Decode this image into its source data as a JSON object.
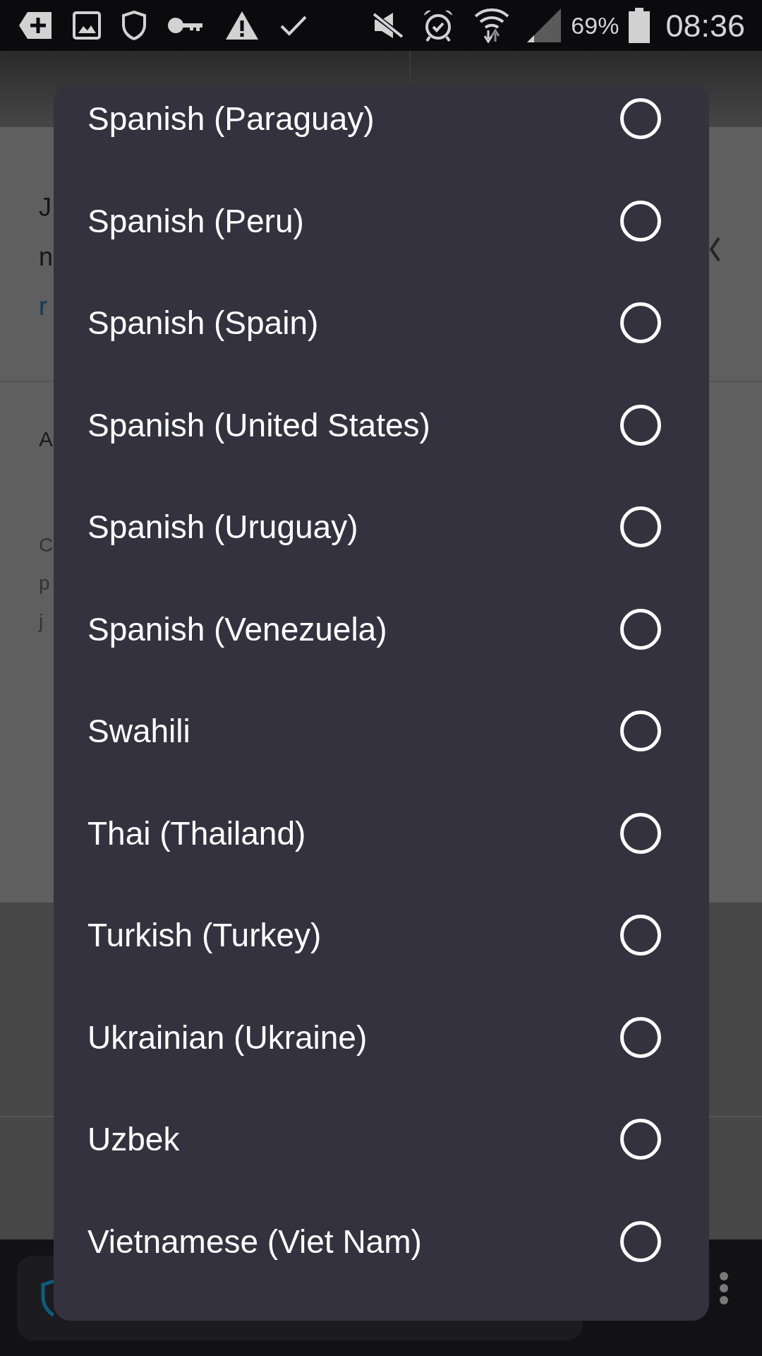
{
  "status_bar": {
    "battery": "69%",
    "time": "08:36"
  },
  "page": {
    "intro": {
      "lines": [
        {
          "text": "J",
          "kind": "text"
        },
        {
          "text": "n",
          "kind": "text"
        },
        {
          "text": "r",
          "kind": "link"
        }
      ]
    },
    "section": {
      "heading": "A",
      "lines": [
        "C",
        "p",
        "j"
      ]
    }
  },
  "dialog": {
    "options": [
      {
        "label": "Spanish (Paraguay)",
        "selected": false
      },
      {
        "label": "Spanish (Peru)",
        "selected": false
      },
      {
        "label": "Spanish (Spain)",
        "selected": false
      },
      {
        "label": "Spanish (United States)",
        "selected": false
      },
      {
        "label": "Spanish (Uruguay)",
        "selected": false
      },
      {
        "label": "Spanish (Venezuela)",
        "selected": false
      },
      {
        "label": "Swahili",
        "selected": false
      },
      {
        "label": "Thai (Thailand)",
        "selected": false
      },
      {
        "label": "Turkish (Turkey)",
        "selected": false
      },
      {
        "label": "Ukrainian (Ukraine)",
        "selected": false
      },
      {
        "label": "Uzbek",
        "selected": false
      },
      {
        "label": "Vietnamese (Viet Nam)",
        "selected": false
      }
    ]
  }
}
